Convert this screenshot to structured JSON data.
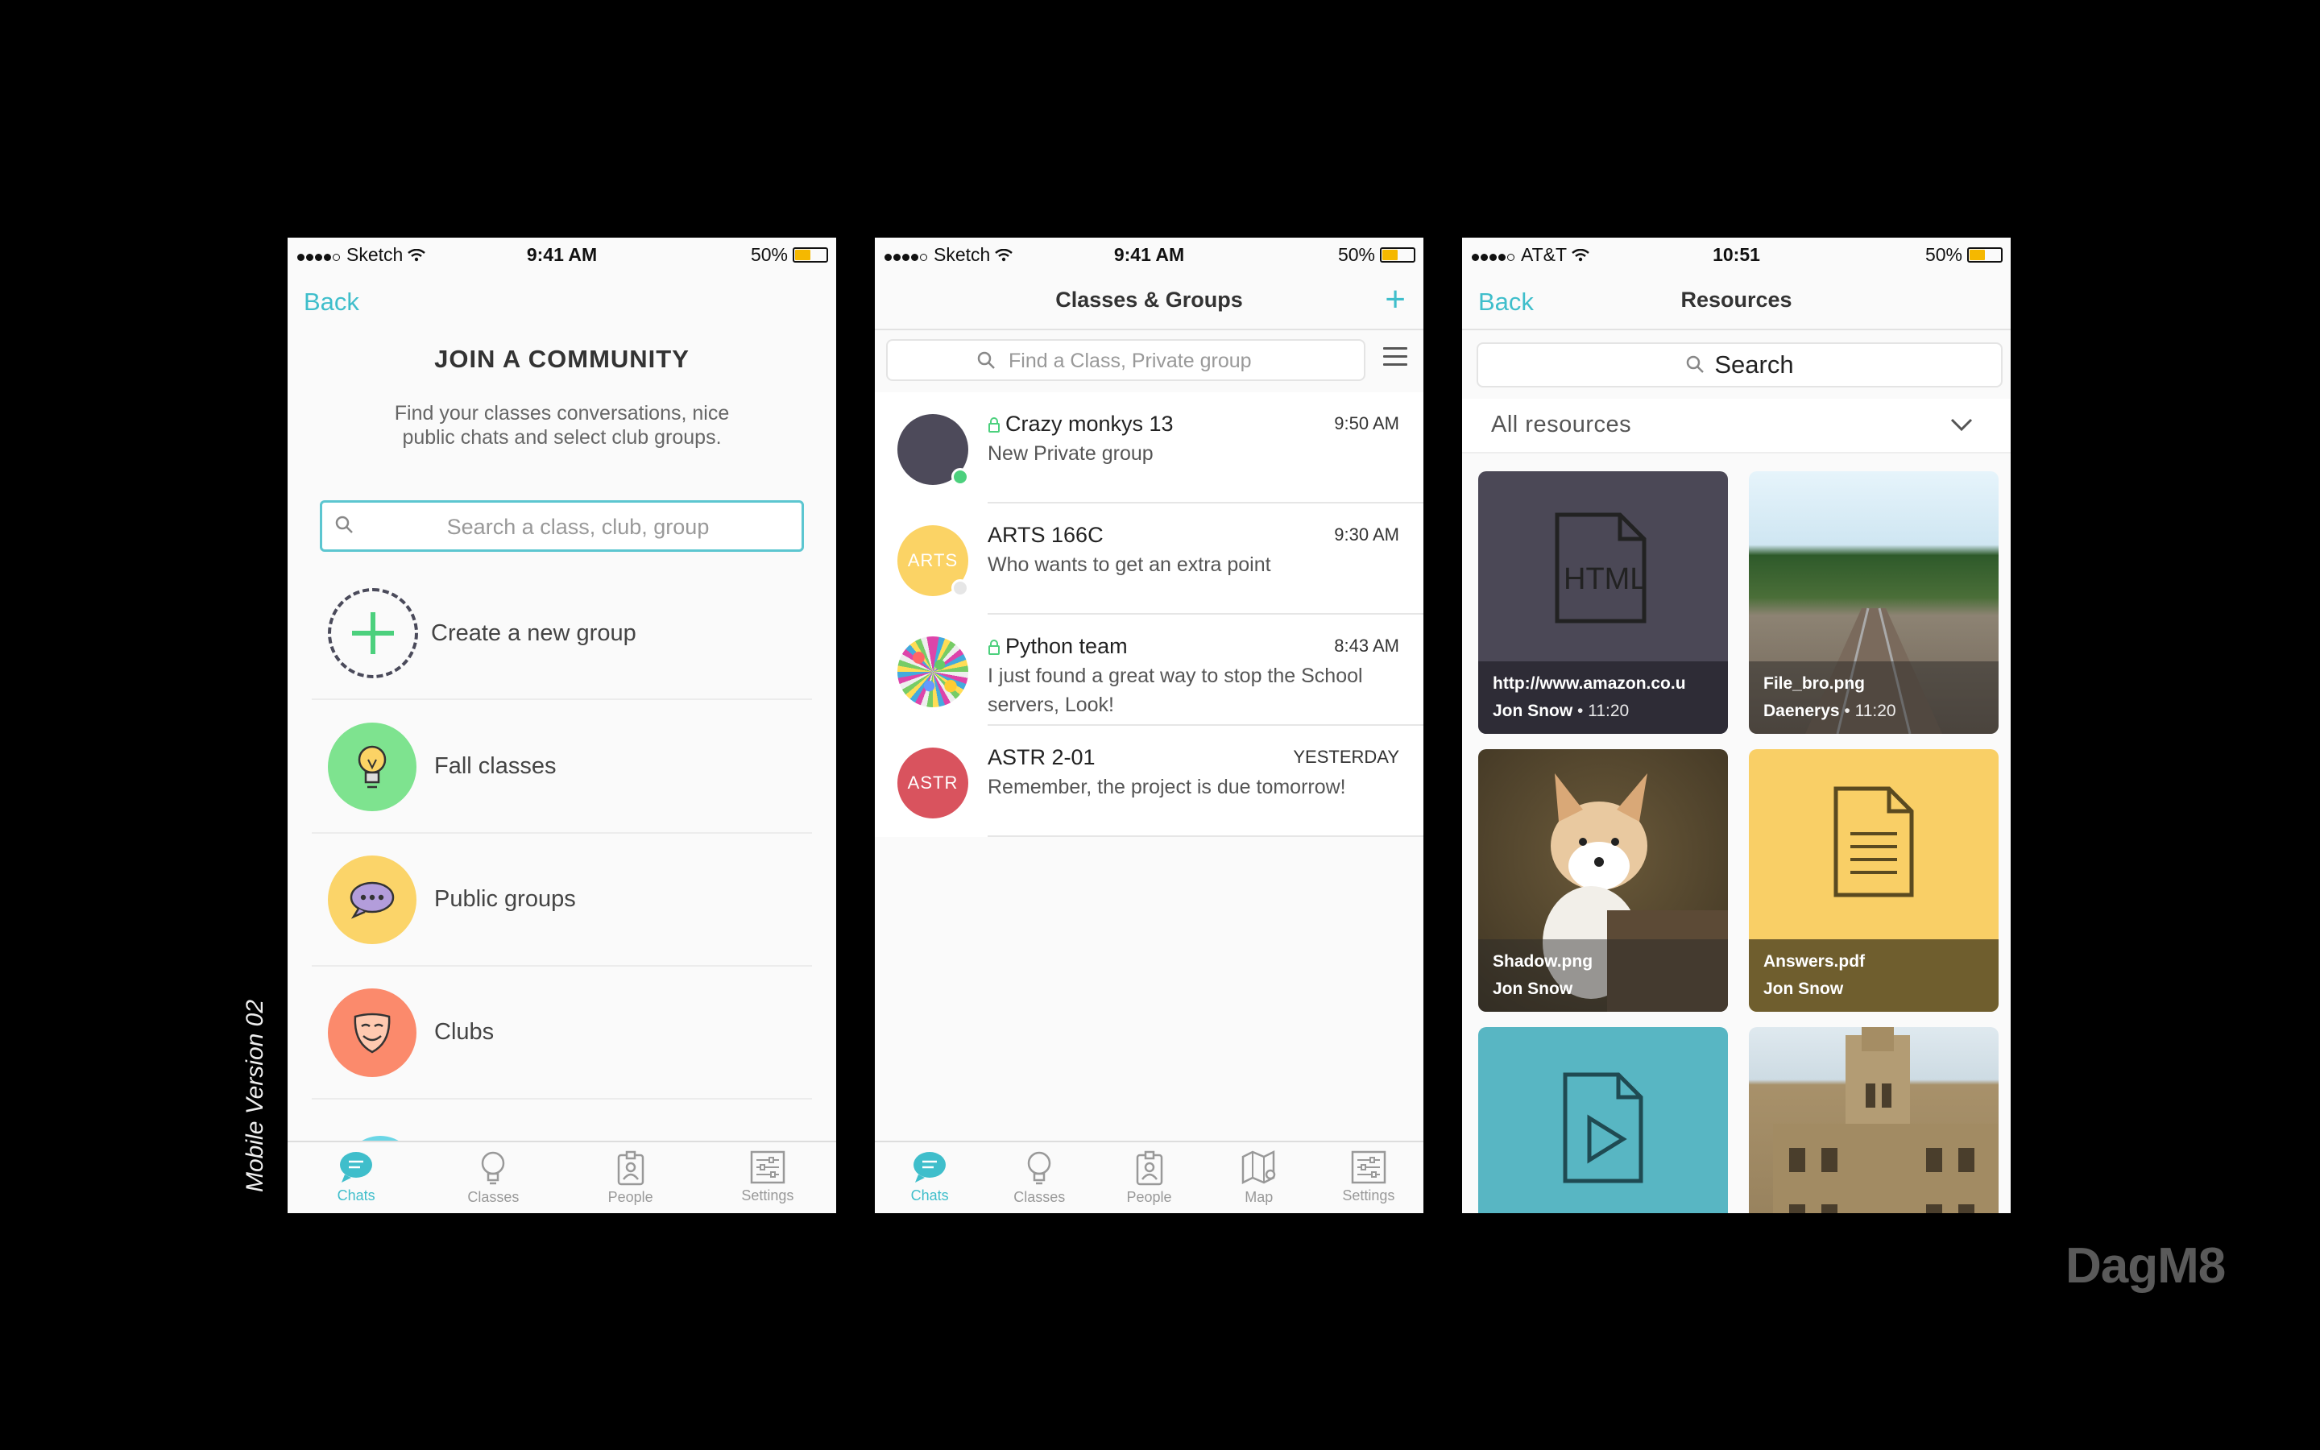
{
  "side_label": "Mobile Version 02",
  "brand": "DagM8",
  "colors": {
    "accent": "#3fbecb",
    "online": "#4cd07d"
  },
  "screen1": {
    "status": {
      "carrier": "Sketch",
      "time": "9:41 AM",
      "battery": "50%"
    },
    "back": "Back",
    "title": "JOIN A COMMUNITY",
    "subtitle": "Find your classes conversations, nice public chats and select club groups.",
    "search_placeholder": "Search a class, club, group",
    "create": "Create a new group",
    "items": [
      {
        "label": "Fall classes",
        "icon": "lightbulb-icon",
        "color": "#7ee38f"
      },
      {
        "label": "Public groups",
        "icon": "speech-bubble-icon",
        "color": "#fbd469"
      },
      {
        "label": "Clubs",
        "icon": "theater-mask-icon",
        "color": "#fb8a6c"
      }
    ],
    "tabs": [
      "Chats",
      "Classes",
      "People",
      "Settings"
    ]
  },
  "screen2": {
    "status": {
      "carrier": "Sketch",
      "time": "9:41 AM",
      "battery": "50%"
    },
    "title": "Classes & Groups",
    "search_placeholder": "Find a Class, Private group",
    "chats": [
      {
        "name": "Crazy monkys 13",
        "time": "9:50 AM",
        "message": "New Private group",
        "avatar": "",
        "private": true,
        "color": "#4d4a5a"
      },
      {
        "name": "ARTS 166C",
        "time": "9:30 AM",
        "message": "Who wants to get an extra point",
        "avatar": "ARTS",
        "private": false,
        "color": "#fbd365"
      },
      {
        "name": "Python team",
        "time": "8:43 AM",
        "message": "I just found a great way to stop the School servers, Look!",
        "avatar": "",
        "private": true,
        "color": "#dcdcdc"
      },
      {
        "name": "ASTR 2-01",
        "time": "YESTERDAY",
        "message": "Remember, the project is due tomorrow!",
        "avatar": "ASTR",
        "private": false,
        "color": "#d9535e"
      }
    ],
    "tabs": [
      "Chats",
      "Classes",
      "People",
      "Map",
      "Settings"
    ]
  },
  "screen3": {
    "status": {
      "carrier": "AT&T",
      "time": "10:51",
      "battery": "50%"
    },
    "back": "Back",
    "title": "Resources",
    "search_placeholder": "Search",
    "filter": "All resources",
    "resources": [
      {
        "file": "http://www.amazon.co.u",
        "user": "Jon Snow",
        "time": "• 11:20",
        "icon": "html-file-icon",
        "bg": "#4b4856"
      },
      {
        "file": "File_bro.png",
        "user": "Daenerys",
        "time": "• 11:20",
        "icon": "railway-photo",
        "bg": "#8aa3a3"
      },
      {
        "file": "Shadow.png",
        "user": "Jon Snow",
        "time": "",
        "icon": "puppy-photo",
        "bg": "#8b6a3e"
      },
      {
        "file": "Answers.pdf",
        "user": "Jon Snow",
        "time": "",
        "icon": "document-icon",
        "bg": "#f9cf66"
      },
      {
        "file": "",
        "user": "",
        "time": "",
        "icon": "video-file-icon",
        "bg": "#58b6c3"
      },
      {
        "file": "",
        "user": "",
        "time": "",
        "icon": "building-photo",
        "bg": "#b8a78a"
      }
    ]
  }
}
